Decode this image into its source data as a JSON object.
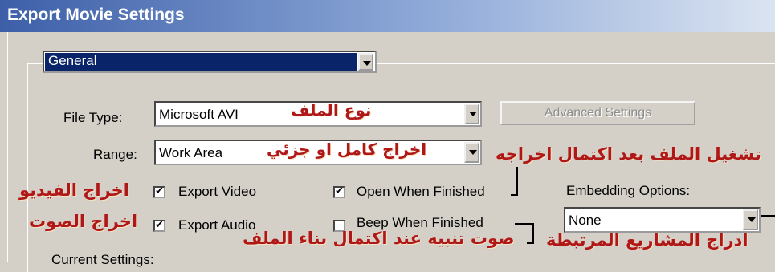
{
  "window": {
    "title": "Export Movie Settings"
  },
  "section": {
    "selected": "General"
  },
  "file_type": {
    "label": "File Type:",
    "value": "Microsoft AVI",
    "annotation": "نوع الملف"
  },
  "advanced_button": {
    "label": "Advanced Settings"
  },
  "range": {
    "label": "Range:",
    "value": "Work Area",
    "annotation": "اخراج كامل او جزئي"
  },
  "export_video": {
    "label": "Export Video",
    "checked": true,
    "annotation": "اخراج الفيديو"
  },
  "export_audio": {
    "label": "Export Audio",
    "checked": true,
    "annotation": "اخراج الصوت"
  },
  "open_when_finished": {
    "label": "Open When Finished",
    "checked": true,
    "annotation": "تشغيل الملف بعد اكتمال اخراجه"
  },
  "beep_when_finished": {
    "label": "Beep When Finished",
    "checked": false,
    "annotation": "صوت تنبيه عند اكتمال بناء الملف"
  },
  "embedding": {
    "label": "Embedding Options:",
    "value": "None",
    "annotation": "ادراج المشاريع المرتبطة"
  },
  "current_settings": {
    "label": "Current Settings:"
  }
}
